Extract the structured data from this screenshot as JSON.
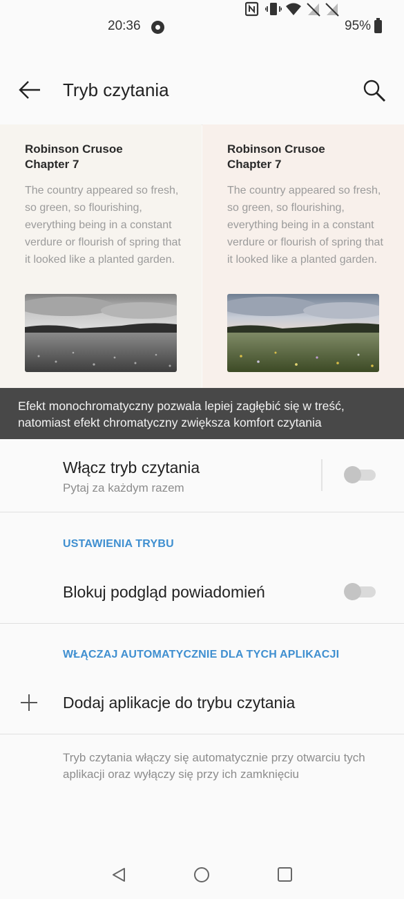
{
  "status_bar": {
    "time": "20:36",
    "battery": "95%",
    "icons": [
      "record-icon",
      "nfc-icon",
      "vibrate-icon",
      "wifi-icon",
      "no-signal-icon",
      "no-signal-icon",
      "battery-icon"
    ]
  },
  "toolbar": {
    "title": "Tryb czytania",
    "back_icon": "arrow-left-icon",
    "search_icon": "search-icon"
  },
  "preview": {
    "monochrome": {
      "heading": "Robinson Crusoe\nChapter 7",
      "text": "The country appeared so fresh, so green, so flourishing, everything being in a constant verdure or flourish of spring that it looked like a planted garden.",
      "image": "grayscale-meadow-photo"
    },
    "chromatic": {
      "heading": "Robinson Crusoe\nChapter 7",
      "text": "The country appeared so fresh, so green, so flourishing, everything being in a constant verdure or flourish of spring that it looked like a planted garden.",
      "image": "color-meadow-photo"
    },
    "caption": "Efekt monochromatyczny pozwala lepiej zagłębić się w treść, natomiast efekt chromatyczny zwiększa komfort czytania"
  },
  "reading_mode": {
    "title": "Włącz tryb czytania",
    "subtitle": "Pytaj za każdym razem",
    "enabled": false
  },
  "mode_settings": {
    "header": "USTAWIENIA TRYBU",
    "block_notifications": {
      "title": "Blokuj podgląd powiadomień",
      "enabled": false
    }
  },
  "auto_apps": {
    "header": "WŁĄCZAJ AUTOMATYCZNIE DLA TYCH APLIKACJI",
    "add_label": "Dodaj aplikacje do trybu czytania",
    "note": "Tryb czytania włączy się automatycznie przy otwarciu tych aplikacji oraz wyłączy się przy ich zamknięciu"
  },
  "nav_bar": {
    "icons": [
      "nav-back-icon",
      "nav-home-icon",
      "nav-recents-icon"
    ]
  },
  "colors": {
    "accent": "#3f8fd0",
    "tooltip_bg": "#484848",
    "background": "#fafafa"
  }
}
